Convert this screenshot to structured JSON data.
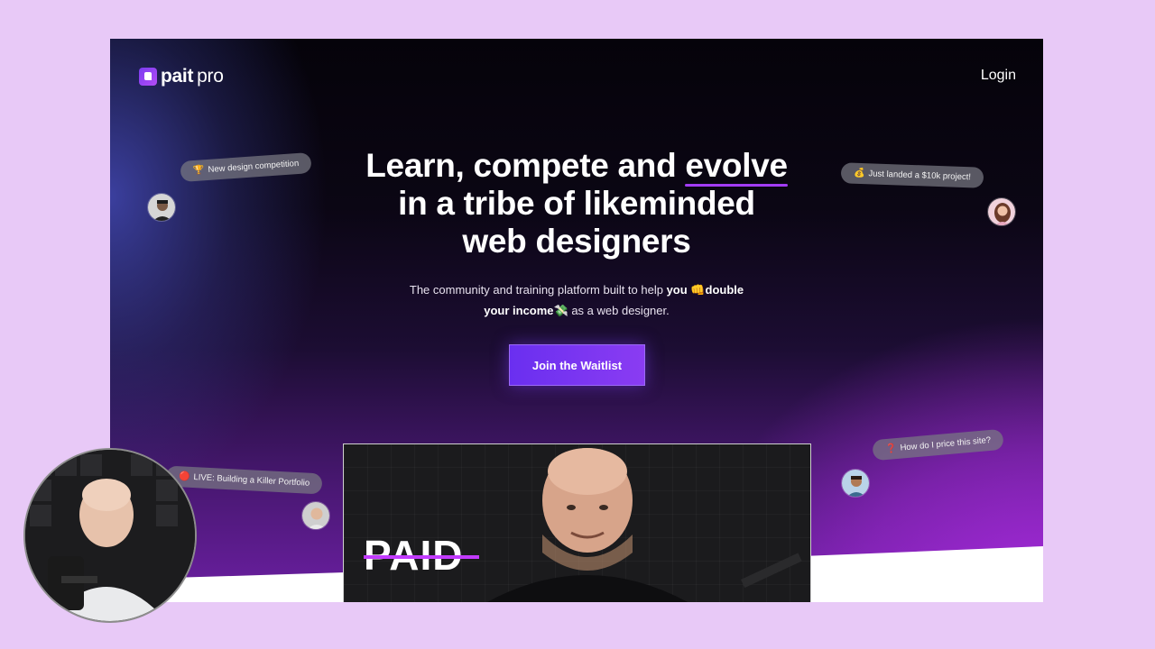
{
  "brand": {
    "name_bold": "pait",
    "name_light": "pro"
  },
  "nav": {
    "login_label": "Login"
  },
  "hero": {
    "headline_line1_pre": "Learn, compete and ",
    "headline_line1_accent": "evolve",
    "headline_line2": "in a tribe of likeminded",
    "headline_line3": "web designers",
    "sub_part1": "The community and training platform built to help ",
    "sub_you": "you",
    "sub_emoji1": "👊",
    "sub_double": "double",
    "sub_income": "your income",
    "sub_emoji2": "💸",
    "sub_part2": " as a web designer.",
    "cta_label": "Join the Waitlist"
  },
  "bubbles": [
    {
      "emoji": "🏆",
      "text": "New design competition"
    },
    {
      "emoji": "💰",
      "text": "Just landed a $10k project!"
    },
    {
      "emoji": "❓",
      "text": "How do I price this site?"
    },
    {
      "emoji": "🔴",
      "text": "LIVE: Building a Killer Portfolio"
    }
  ],
  "video": {
    "overlay_text": "PAID"
  },
  "colors": {
    "page_bg": "#e8c9f7",
    "accent": "#8a3cf2",
    "underline": "#a23cf5",
    "strike": "#c23bff"
  }
}
